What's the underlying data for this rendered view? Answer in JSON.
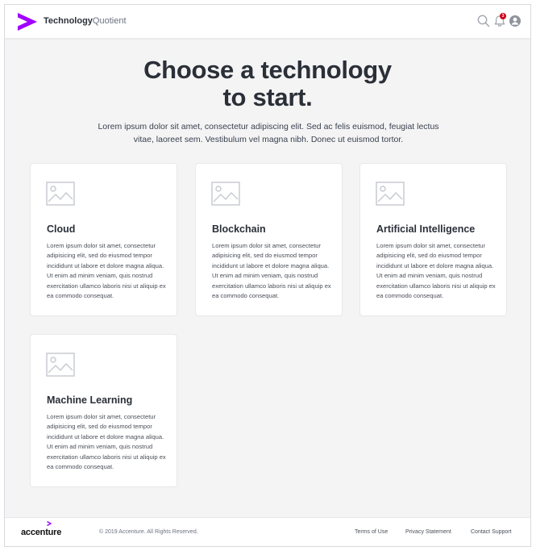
{
  "header": {
    "brand_bold": "Technology",
    "brand_light": "Quotient",
    "notification_count": "3",
    "icons": [
      "logo-chevron-icon",
      "search-icon",
      "bell-icon",
      "user-icon"
    ]
  },
  "hero": {
    "title_line1": "Choose a technology",
    "title_line2": "to start.",
    "subtitle": "Lorem ipsum dolor sit amet, consectetur adipiscing elit. Sed ac felis euismod, feugiat lectus vitae, laoreet sem. Vestibulum vel magna nibh. Donec ut euismod tortor."
  },
  "cards": [
    {
      "title": "Cloud",
      "description": "Lorem ipsum dolor sit amet, consectetur adipisicing elit, sed do eiusmod tempor incididunt ut labore et dolore magna aliqua. Ut enim ad minim veniam, quis nostrud exercitation ullamco laboris nisi ut aliquip ex ea commodo consequat."
    },
    {
      "title": "Blockchain",
      "description": "Lorem ipsum dolor sit amet, consectetur adipisicing elit, sed do eiusmod tempor incididunt ut labore et dolore magna aliqua. Ut enim ad minim veniam, quis nostrud exercitation ullamco laboris nisi ut aliquip ex ea commodo consequat."
    },
    {
      "title": "Artificial Intelligence",
      "description": "Lorem ipsum dolor sit amet, consectetur adipisicing elit, sed do eiusmod tempor incididunt ut labore et dolore magna aliqua. Ut enim ad minim veniam, quis nostrud exercitation ullamco laboris nisi ut aliquip ex ea commodo consequat."
    },
    {
      "title": "Machine Learning",
      "description": "Lorem ipsum dolor sit amet, consectetur adipisicing elit, sed do eiusmod tempor incididunt ut labore et dolore magna aliqua. Ut enim ad minim veniam, quis nostrud exercitation ullamco laboris nisi ut aliquip ex ea commodo consequat."
    }
  ],
  "footer": {
    "logo_text": "accenture",
    "copyright": "© 2019 Accenture. All Rights Reserved.",
    "links": [
      "Terms of Use",
      "Privacy Statement",
      "Contact Support"
    ]
  },
  "colors": {
    "brand_purple": "#a100ff",
    "background": "#f4f4f4",
    "text_dark": "#2a2f38",
    "badge_red": "#d0021b",
    "placeholder_icon": "#c8ccd2"
  }
}
